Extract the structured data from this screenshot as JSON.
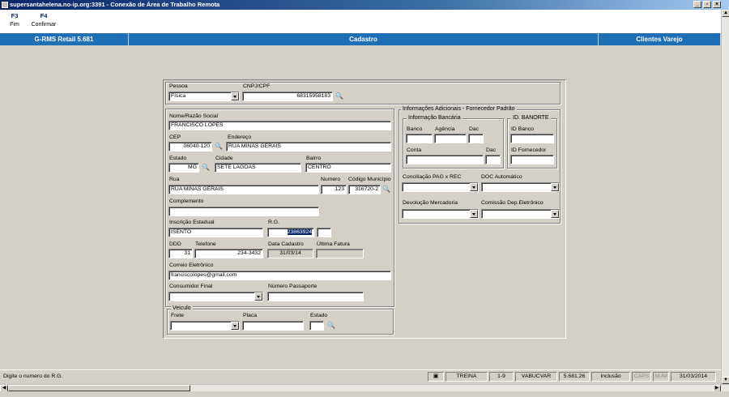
{
  "window": {
    "title": "supersantahelena.no-ip.org:3391 - Conexão de Área de Trabalho Remota"
  },
  "toolbar": {
    "items": [
      {
        "key": "F3",
        "label": "Fim"
      },
      {
        "key": "F4",
        "label": "Confirmar"
      }
    ]
  },
  "header": {
    "left": "G-RMS Retail 5.681",
    "center": "Cadastro",
    "right": "Clientes Varejo"
  },
  "pessoa": {
    "label": "Pessoa",
    "value": "Física",
    "cnpj_label": "CNPJ/CPF",
    "cnpj_value": "68315958183"
  },
  "form": {
    "nome_label": "Nome/Razão Social",
    "nome_value": "FRANCISCO LOPES",
    "cep_label": "CEP",
    "cep_value": "06040-120",
    "endereco_label": "Endereço",
    "endereco_value": "RUA MINAS GERAIS",
    "estado_label": "Estado",
    "estado_value": "MG",
    "cidade_label": "Cidade",
    "cidade_value": "SETE LAGOAS",
    "bairro_label": "Bairro",
    "bairro_value": "CENTRO",
    "rua_label": "Rua",
    "rua_value": "RUA MINAS GERAIS",
    "numero_label": "Numero",
    "numero_value": "123",
    "codmun_label": "Código Município",
    "codmun_value": "316720-2",
    "complemento_label": "Complemento",
    "complemento_value": "",
    "ie_label": "Inscrição Estadual",
    "ie_value": "ISENTO",
    "rg_label": "R.G.",
    "rg_value": "23863924",
    "ddd_label": "DDD",
    "ddd_value": "31",
    "telefone_label": "Telefone",
    "telefone_value": "234-3432",
    "datacad_label": "Data Cadastro",
    "datacad_value": "31/03/14",
    "ultfat_label": "Última Fatura",
    "ultfat_value": "",
    "email_label": "Correio Eletrônico",
    "email_value": "franciscolopes@gmail.com",
    "consumidor_label": "Consumidor Final",
    "consumidor_value": "",
    "passaporte_label": "Número Passaporte",
    "passaporte_value": ""
  },
  "veiculo": {
    "title": "Veiculo",
    "frete_label": "Frete",
    "placa_label": "Placa",
    "estado_label": "Estado"
  },
  "info": {
    "title": "Informações Adicionais - Fornecedor Padrão",
    "bancaria_title": "Informação Bancária",
    "banco_label": "Banco",
    "agencia_label": "Agência",
    "dac_label": "Dac",
    "conta_label": "Conta",
    "dac2_label": "Dac",
    "banorte_title": "ID. BANORTE",
    "idbanco_label": "ID Banco",
    "idforn_label": "ID Fornecedor",
    "conciliacao_label": "Conciliação PAG x REC",
    "docauto_label": "DOC Automático",
    "devolucao_label": "Devolução Mercadoria",
    "comissao_label": "Comissão Dep.Eletrônico"
  },
  "status": {
    "message": "Digite o numero do R.G.",
    "cells": [
      "TREINA",
      "1-9",
      "VABUCVAR",
      "5.681.26",
      "Inclusão",
      "CAPS",
      "NUM",
      "31/03/2014"
    ]
  }
}
